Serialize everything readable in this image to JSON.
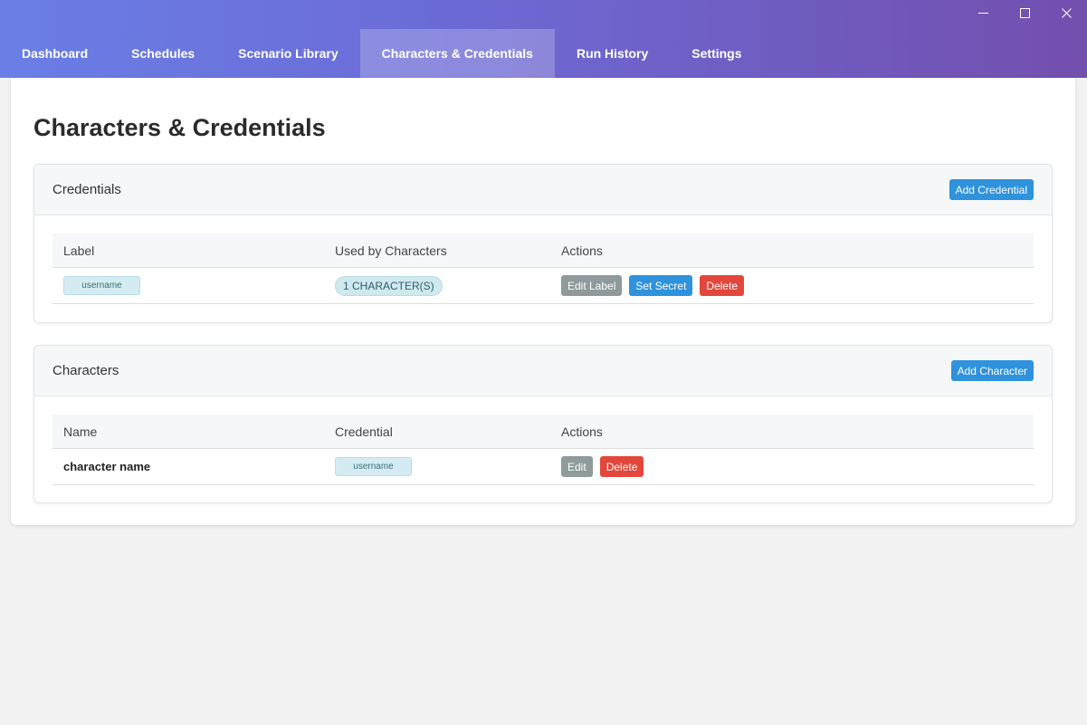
{
  "window": {
    "controls": [
      {
        "name": "minimize-icon",
        "glyph": "—"
      },
      {
        "name": "maximize-icon",
        "glyph": "☐"
      },
      {
        "name": "close-icon",
        "glyph": "✕"
      }
    ]
  },
  "nav": {
    "tabs": [
      {
        "label": "Dashboard"
      },
      {
        "label": "Schedules"
      },
      {
        "label": "Scenario Library"
      },
      {
        "label": "Characters & Credentials",
        "active": true
      },
      {
        "label": "Run History"
      },
      {
        "label": "Settings"
      }
    ]
  },
  "page": {
    "title": "Characters & Credentials"
  },
  "credentials": {
    "title": "Credentials",
    "add_label": "Add Credential",
    "columns": [
      "Label",
      "Used by Characters",
      "Actions"
    ],
    "rows": [
      {
        "label": "username",
        "used_by": "1 CHARACTER(S)",
        "actions": {
          "edit": "Edit Label",
          "secret": "Set Secret",
          "delete": "Delete"
        }
      }
    ]
  },
  "characters": {
    "title": "Characters",
    "add_label": "Add Character",
    "columns": [
      "Name",
      "Credential",
      "Actions"
    ],
    "rows": [
      {
        "name": "character name",
        "credential": "username",
        "actions": {
          "edit": "Edit",
          "delete": "Delete"
        }
      }
    ]
  },
  "colors": {
    "header_gradient_start": "#6a7fe6",
    "header_gradient_end": "#734fae",
    "primary": "#2f92dc",
    "secondary": "#8e9a9b",
    "danger": "#e3473b",
    "tag_bg": "#d4ecf1"
  }
}
